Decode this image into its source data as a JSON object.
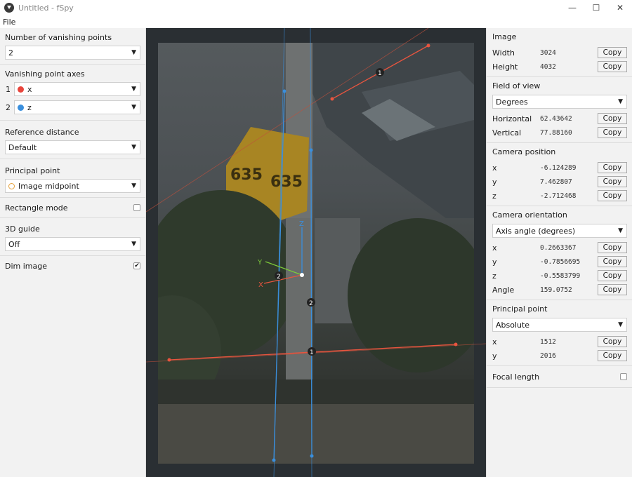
{
  "window": {
    "title": "Untitled - fSpy",
    "minimize": "—",
    "maximize": "☐",
    "close": "✕"
  },
  "menu": {
    "file": "File"
  },
  "left": {
    "vp_count_label": "Number of vanishing points",
    "vp_count_value": "2",
    "vp_axes_label": "Vanishing point axes",
    "vp_axes": [
      {
        "num": "1",
        "axis": "x",
        "color": "#e8453c"
      },
      {
        "num": "2",
        "axis": "z",
        "color": "#3a8fdd"
      }
    ],
    "ref_dist_label": "Reference distance",
    "ref_dist_value": "Default",
    "principal_label": "Principal point",
    "principal_value": "Image midpoint",
    "rect_mode_label": "Rectangle mode",
    "rect_mode_checked": false,
    "guide_label": "3D guide",
    "guide_value": "Off",
    "dim_label": "Dim image",
    "dim_checked": true
  },
  "canvas": {
    "vp_labels": [
      "1",
      "2",
      "1",
      "2"
    ],
    "axis_labels": {
      "x": "X",
      "y": "Y",
      "z": "Z"
    }
  },
  "right": {
    "copy_label": "Copy",
    "image": {
      "label": "Image",
      "width_key": "Width",
      "width": "3024",
      "height_key": "Height",
      "height": "4032"
    },
    "fov": {
      "label": "Field of view",
      "unit": "Degrees",
      "h_key": "Horizontal",
      "h": "62.43642",
      "v_key": "Vertical",
      "v": "77.88160"
    },
    "cam_pos": {
      "label": "Camera position",
      "x_key": "x",
      "x": "-6.124289",
      "y_key": "y",
      "y": "7.462807",
      "z_key": "z",
      "z": "-2.712468"
    },
    "cam_orient": {
      "label": "Camera orientation",
      "mode": "Axis angle (degrees)",
      "x_key": "x",
      "x": "0.2663367",
      "y_key": "y",
      "y": "-0.7856695",
      "z_key": "z",
      "z": "-0.5583799",
      "a_key": "Angle",
      "angle": "159.0752"
    },
    "principal": {
      "label": "Principal point",
      "mode": "Absolute",
      "x_key": "x",
      "x": "1512",
      "y_key": "y",
      "y": "2016"
    },
    "focal_label": "Focal length",
    "focal_checked": false
  }
}
